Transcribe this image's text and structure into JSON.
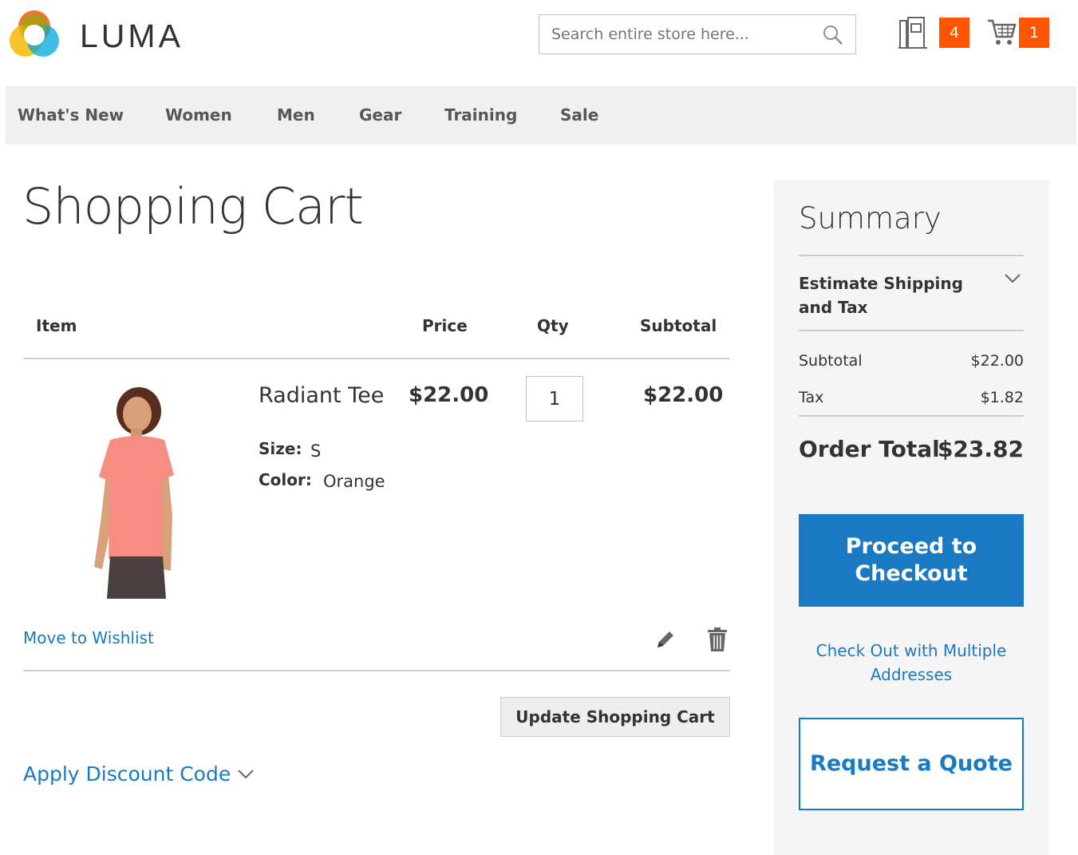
{
  "header": {
    "logo_text": "LUMA",
    "search": {
      "placeholder": "Search entire store here..."
    },
    "compare_count": "4",
    "cart_count": "1"
  },
  "nav": {
    "items": [
      "What's New",
      "Women",
      "Men",
      "Gear",
      "Training",
      "Sale"
    ]
  },
  "page": {
    "title": "Shopping Cart"
  },
  "cart": {
    "columns": {
      "item": "Item",
      "price": "Price",
      "qty": "Qty",
      "subtotal": "Subtotal"
    },
    "items": [
      {
        "name": "Radiant Tee",
        "price": "$22.00",
        "qty": "1",
        "subtotal": "$22.00",
        "size_label": "Size:",
        "size": "S",
        "color_label": "Color:",
        "color": "Orange",
        "move_to_wishlist": "Move to Wishlist"
      }
    ],
    "update_button": "Update Shopping Cart",
    "discount_link": "Apply Discount Code"
  },
  "summary": {
    "title": "Summary",
    "estimate_shipping": "Estimate Shipping and Tax",
    "subtotal_label": "Subtotal",
    "subtotal_value": "$22.00",
    "tax_label": "Tax",
    "tax_value": "$1.82",
    "order_total_label": "Order Total",
    "order_total_value": "$23.82",
    "checkout_button": "Proceed to Checkout",
    "multi_address_link": "Check Out with Multiple Addresses",
    "quote_button": "Request a Quote"
  },
  "colors": {
    "accent": "#1979c3",
    "badge": "#ff5501",
    "nav_bg": "#f0f0f0",
    "summary_bg": "#f5f5f5"
  },
  "icons": [
    "luma-logo-icon",
    "search-icon",
    "compare-icon",
    "cart-icon",
    "edit-icon",
    "trash-icon",
    "chevron-down-icon"
  ]
}
